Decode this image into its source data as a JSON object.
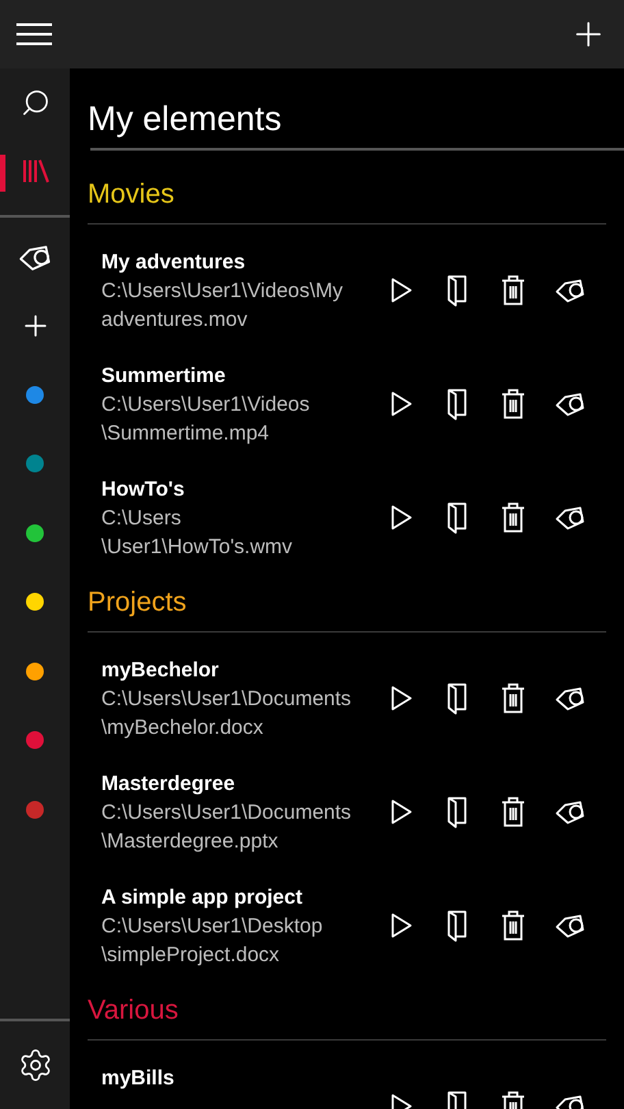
{
  "sidebar": {
    "nav_items": [
      {
        "kind": "search",
        "selected": false
      },
      {
        "kind": "library",
        "selected": true
      }
    ],
    "tool_items": [
      {
        "kind": "tag"
      },
      {
        "kind": "add"
      }
    ],
    "color_filters": [
      {
        "color": "#1e88e5"
      },
      {
        "color": "#00838f"
      },
      {
        "color": "#22c33a"
      },
      {
        "color": "#ffd500"
      },
      {
        "color": "#ffa000"
      },
      {
        "color": "#e0103a"
      },
      {
        "color": "#c62828"
      }
    ]
  },
  "page_title": "My elements",
  "sections": [
    {
      "title": "Movies",
      "color": "#e6c619",
      "items": [
        {
          "name": "My adventures",
          "path_lines": [
            "C:\\Users\\User1\\Videos\\My",
            "adventures.mov"
          ]
        },
        {
          "name": "Summertime",
          "path_lines": [
            "C:\\Users\\User1\\Videos",
            "\\Summertime.mp4"
          ]
        },
        {
          "name": "HowTo's",
          "path_lines": [
            "C:\\Users",
            "\\User1\\HowTo's.wmv"
          ]
        }
      ]
    },
    {
      "title": "Projects",
      "color": "#f0a31c",
      "items": [
        {
          "name": "myBechelor",
          "path_lines": [
            "C:\\Users\\User1\\Documents",
            "\\myBechelor.docx"
          ]
        },
        {
          "name": "Masterdegree",
          "path_lines": [
            "C:\\Users\\User1\\Documents",
            "\\Masterdegree.pptx"
          ]
        },
        {
          "name": "A simple app project",
          "path_lines": [
            "C:\\Users\\User1\\Desktop",
            "\\simpleProject.docx"
          ]
        }
      ]
    },
    {
      "title": "Various",
      "color": "#d8163e",
      "items": [
        {
          "name": "myBills"
        }
      ]
    }
  ]
}
